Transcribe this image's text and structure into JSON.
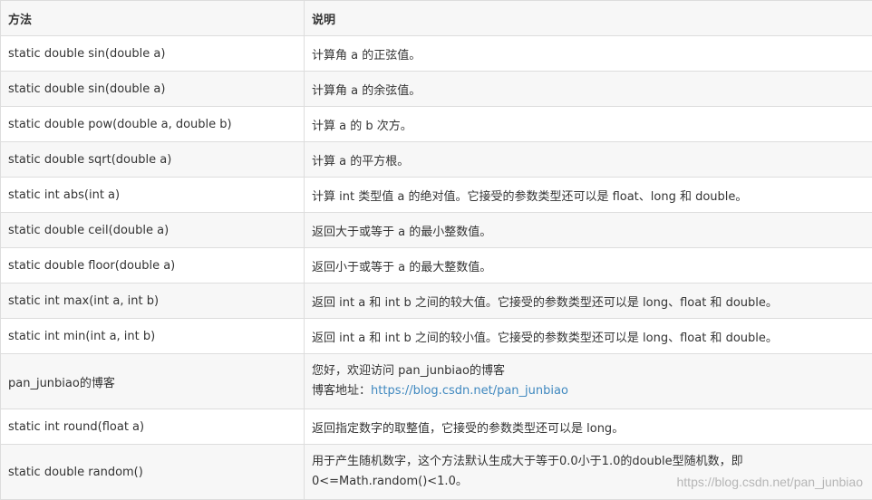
{
  "header": {
    "col_method": "方法",
    "col_desc": "说明"
  },
  "rows": [
    {
      "method": "static double sin(double a)",
      "desc": "计算角 a 的正弦值。"
    },
    {
      "method": "static double sin(double a)",
      "desc": "计算角 a 的余弦值。"
    },
    {
      "method": "static double pow(double a, double b)",
      "desc": "计算 a 的 b 次方。"
    },
    {
      "method": "static double sqrt(double a)",
      "desc": "计算 a 的平方根。"
    },
    {
      "method": "static int abs(int a)",
      "desc": "计算 int 类型值 a 的绝对值。它接受的参数类型还可以是 float、long 和 double。"
    },
    {
      "method": "static double ceil(double a)",
      "desc": "返回大于或等于 a 的最小整数值。"
    },
    {
      "method": "static double floor(double a)",
      "desc": "返回小于或等于 a 的最大整数值。"
    },
    {
      "method": "static int max(int a, int b)",
      "desc": "返回 int a 和 int b 之间的较大值。它接受的参数类型还可以是 long、float 和 double。"
    },
    {
      "method": "static int min(int a, int b)",
      "desc": "返回 int a 和 int b 之间的较小值。它接受的参数类型还可以是 long、float 和 double。"
    },
    {
      "method": "pan_junbiao的博客",
      "desc_line1": "您好，欢迎访问 pan_junbiao的博客",
      "desc_line2_prefix": "博客地址：",
      "desc_link": "https://blog.csdn.net/pan_junbiao"
    },
    {
      "method": "static int round(float a)",
      "desc": "返回指定数字的取整值，它接受的参数类型还可以是 long。"
    },
    {
      "method": "static double random()",
      "desc_line1": "用于产生随机数字，这个方法默认生成大于等于0.0小于1.0的double型随机数，即",
      "desc_line2": "0<=Math.random()<1.0。"
    }
  ],
  "watermark": "https://blog.csdn.net/pan_junbiao",
  "colors": {
    "link": "#3f88bf",
    "border": "#dddddd",
    "stripe": "#f7f7f7"
  }
}
